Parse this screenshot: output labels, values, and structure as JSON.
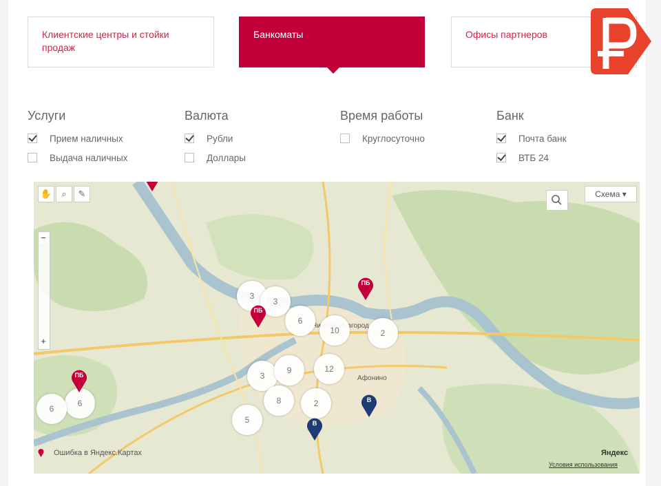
{
  "tabs": [
    {
      "label": "Клиентские центры и стойки продаж",
      "active": false
    },
    {
      "label": "Банкоматы",
      "active": true
    },
    {
      "label": "Офисы партнеров",
      "active": false
    }
  ],
  "logo": {
    "icon": "ruble-logo-icon",
    "color": "#e8412c"
  },
  "filters": {
    "services": {
      "title": "Услуги",
      "options": [
        {
          "label": "Прием наличных",
          "checked": true
        },
        {
          "label": "Выдача наличных",
          "checked": false
        }
      ]
    },
    "currency": {
      "title": "Валюта",
      "options": [
        {
          "label": "Рубли",
          "checked": true
        },
        {
          "label": "Доллары",
          "checked": false
        }
      ]
    },
    "hours": {
      "title": "Время работы",
      "options": [
        {
          "label": "Круглосуточно",
          "checked": false
        }
      ]
    },
    "bank": {
      "title": "Банк",
      "options": [
        {
          "label": "Почта банк",
          "checked": true
        },
        {
          "label": "ВТБ 24",
          "checked": true
        }
      ]
    }
  },
  "map": {
    "scheme_label": "Схема ▾",
    "report_text": "Ошибка в Яндекс.Картах",
    "provider_mark": "Яндекс",
    "license_text": "Условия использования",
    "city_label": "Нижний Новгород",
    "district_label": "Афонино",
    "clusters": [
      "3",
      "3",
      "6",
      "10",
      "2",
      "3",
      "9",
      "12",
      "6",
      "8",
      "2",
      "5",
      "6"
    ],
    "pins": [
      {
        "label": "ПБ",
        "color": "#c4003a"
      },
      {
        "label": "ПБ",
        "color": "#c4003a"
      },
      {
        "label": "ПБ",
        "color": "#c4003a"
      },
      {
        "label": "ПБ",
        "color": "#c4003a"
      },
      {
        "label": "В",
        "color": "#1f3b73"
      },
      {
        "label": "В",
        "color": "#1f3b73"
      }
    ]
  },
  "colors": {
    "accent": "#c4003a",
    "tab_text": "#c8274a",
    "map_bg": "#e6e8d2",
    "river": "#a9c3cf",
    "forest": "#c9dcb0"
  }
}
